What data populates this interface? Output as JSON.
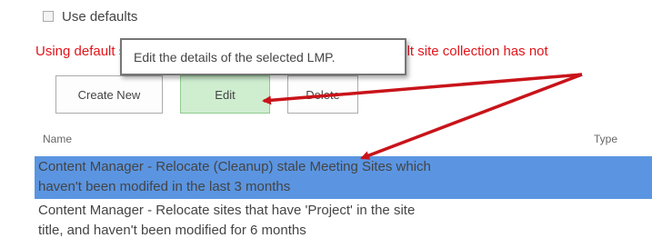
{
  "options": {
    "use_defaults_label": "Use defaults",
    "use_defaults_checked": false
  },
  "warning": {
    "text": "Using default site collection is not possible because the default site collection has not"
  },
  "tooltip": {
    "text": "Edit the details of the selected LMP."
  },
  "toolbar": {
    "create_label": "Create New",
    "edit_label": "Edit",
    "delete_label": "Delete"
  },
  "table": {
    "columns": [
      "Name",
      "Type"
    ],
    "rows": [
      {
        "name_line1": "Content Manager - Relocate (Cleanup) stale Meeting Sites which",
        "name_line2": "haven't been modifed in the last 3 months",
        "selected": true
      },
      {
        "name_line1": "Content Manager - Relocate sites that have 'Project' in the site",
        "name_line2": "title, and haven't been modified for 6 months",
        "selected": false
      }
    ]
  },
  "colors": {
    "selected_row": "#5b95e1",
    "warning": "#e2141b",
    "edit_button": "#cfeed0",
    "annotation_arrow": "#c8141a"
  }
}
